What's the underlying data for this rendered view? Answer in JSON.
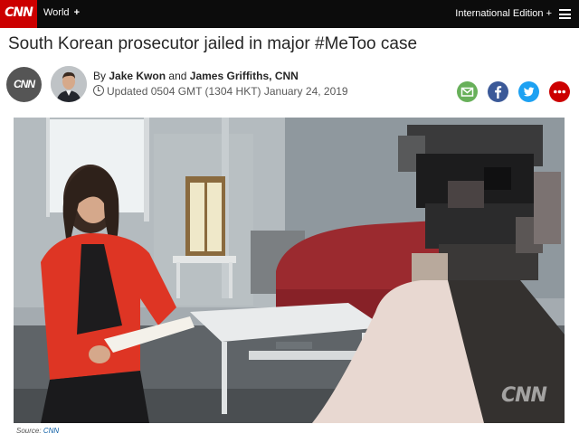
{
  "nav": {
    "logo": "CNN",
    "section": "World",
    "section_plus": "+",
    "edition": "International Edition +"
  },
  "article": {
    "headline": "South Korean prosecutor jailed in major #MeToo case",
    "byline": {
      "prefix": "By",
      "author1": "Jake Kwon",
      "conj": "and",
      "author2": "James Griffiths",
      "outlet": ", CNN"
    },
    "updated": "Updated 0504 GMT (1304 HKT) January 24, 2019",
    "badge_logo": "CNN"
  },
  "share": [
    {
      "name": "email",
      "color": "#68b05a"
    },
    {
      "name": "facebook",
      "color": "#3b5998"
    },
    {
      "name": "twitter",
      "color": "#1da1f2"
    },
    {
      "name": "more",
      "color": "#cc0000"
    }
  ],
  "media": {
    "watermark": "CNN",
    "source_label": "Source:",
    "source_link": "CNN"
  }
}
